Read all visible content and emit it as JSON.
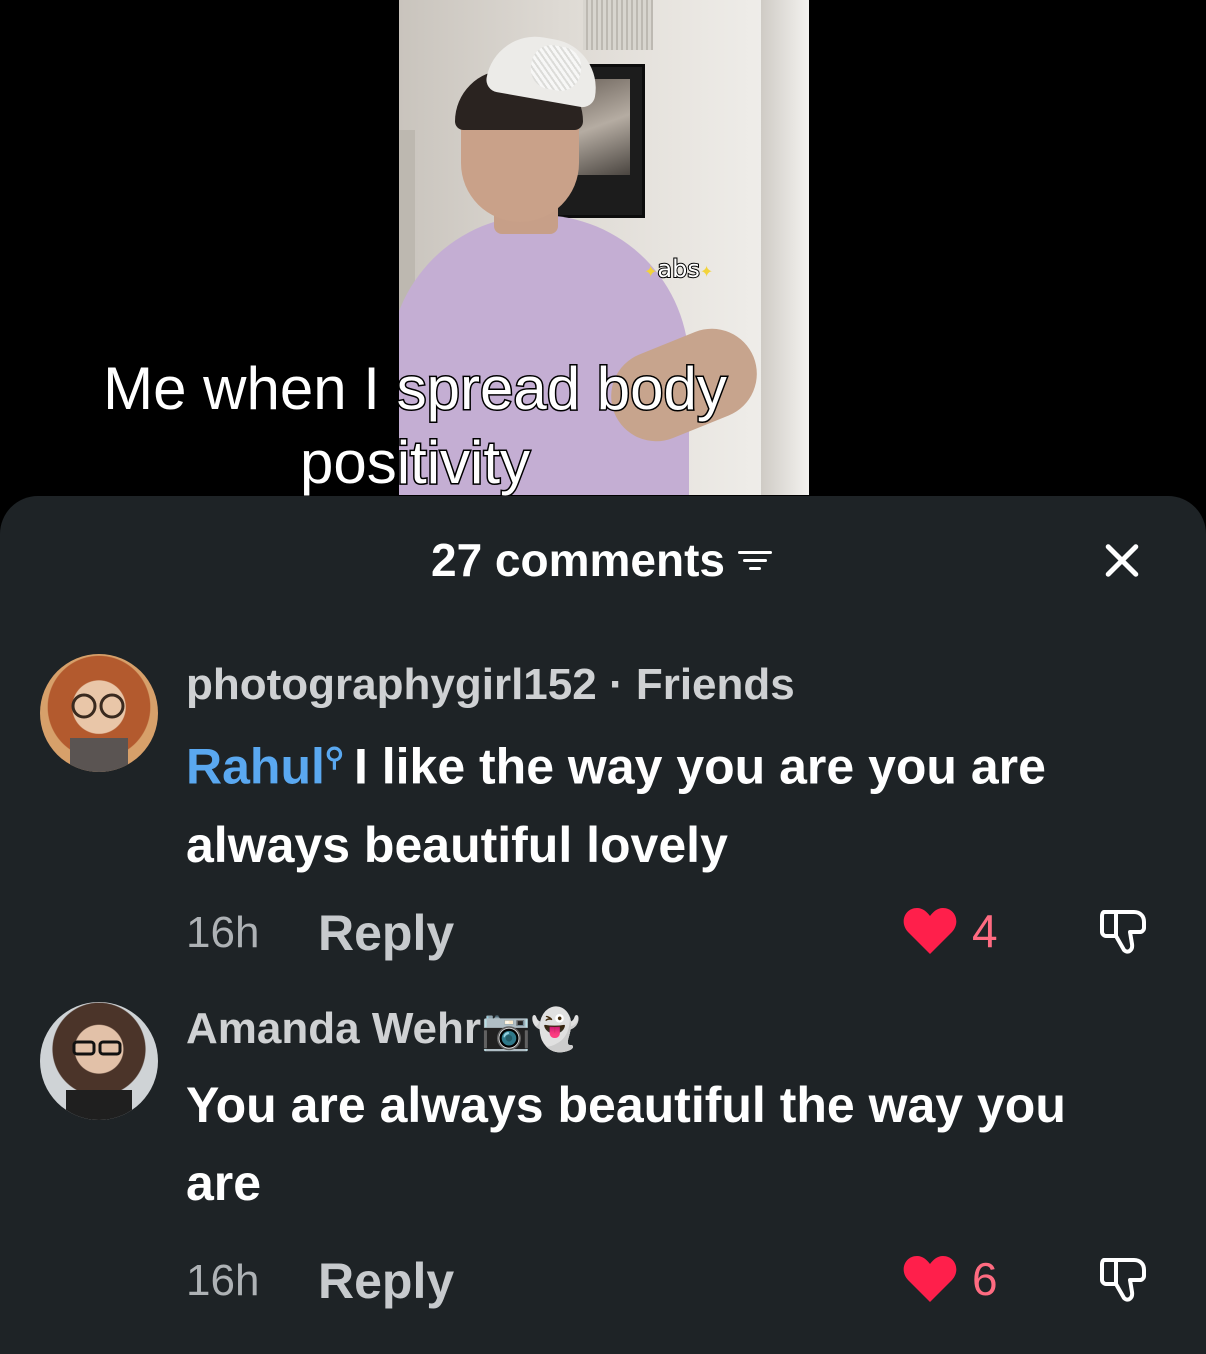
{
  "video": {
    "sticker_text": "abs",
    "caption": "Me when I spread body positivity"
  },
  "comments_header": {
    "count_label": "27 comments",
    "icons": [
      "filter-icon",
      "close-icon"
    ]
  },
  "comments": [
    {
      "username": "photographygirl152",
      "relationship": "· Friends",
      "mention": "Rahul",
      "text": "I like the way you are you are always beautiful lovely",
      "timestamp": "16h",
      "reply_label": "Reply",
      "likes": "4",
      "liked": true
    },
    {
      "username": "Amanda Wehr",
      "username_emoji": "📷👻",
      "text": "You are always beautiful the way you are",
      "timestamp": "16h",
      "reply_label": "Reply",
      "likes": "6",
      "liked": true
    }
  ],
  "colors": {
    "sheet_background": "#1e2326",
    "mention": "#5aa8f0",
    "heart": "#ff1f4b",
    "like_count": "#ff6b81"
  }
}
